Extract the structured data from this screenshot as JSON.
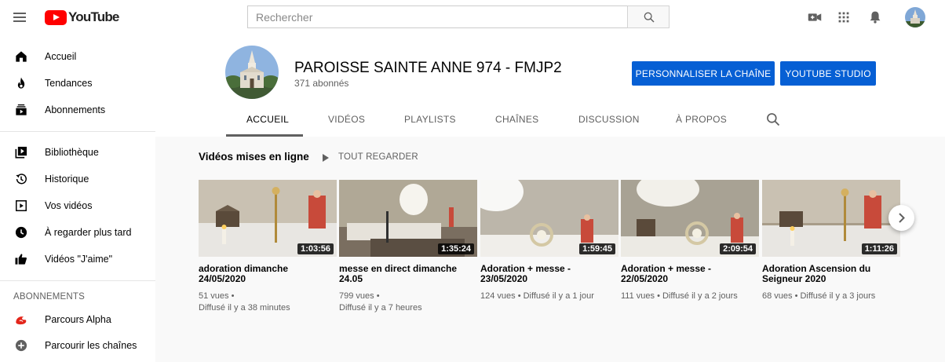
{
  "topbar": {
    "logo_text": "YouTube",
    "search_placeholder": "Rechercher",
    "icons": [
      "menu-icon",
      "search-icon",
      "video-camera-icon",
      "apps-grid-icon",
      "bell-icon",
      "avatar"
    ]
  },
  "sidebar": {
    "main": [
      {
        "label": "Accueil",
        "icon": "home-icon"
      },
      {
        "label": "Tendances",
        "icon": "flame-icon"
      },
      {
        "label": "Abonnements",
        "icon": "subscriptions-icon"
      }
    ],
    "library": [
      {
        "label": "Bibliothèque",
        "icon": "library-icon"
      },
      {
        "label": "Historique",
        "icon": "history-icon"
      },
      {
        "label": "Vos vidéos",
        "icon": "your-videos-icon"
      },
      {
        "label": "À regarder plus tard",
        "icon": "clock-icon"
      },
      {
        "label": "Vidéos \"J'aime\"",
        "icon": "thumbs-up-icon"
      }
    ],
    "subscriptions_title": "ABONNEMENTS",
    "subscriptions": [
      {
        "label": "Parcours Alpha",
        "icon": "alpha-logo-icon"
      },
      {
        "label": "Parcourir les chaînes",
        "icon": "plus-circle-icon"
      }
    ]
  },
  "channel": {
    "name": "PAROISSE SAINTE ANNE 974 - FMJP2",
    "subscribers": "371 abonnés",
    "customize_button": "PERSONNALISER LA CHAÎNE",
    "studio_button": "YOUTUBE STUDIO",
    "tabs": [
      "ACCUEIL",
      "VIDÉOS",
      "PLAYLISTS",
      "CHAÎNES",
      "DISCUSSION",
      "À PROPOS"
    ],
    "active_tab": "ACCUEIL"
  },
  "shelf": {
    "title": "Vidéos mises en ligne",
    "play_all": "TOUT REGARDER",
    "videos": [
      {
        "title": "adoration dimanche 24/05/2020",
        "duration": "1:03:56",
        "views": "51 vues •",
        "age": "Diffusé il y a 38 minutes"
      },
      {
        "title": "messe en direct dimanche 24.05",
        "duration": "1:35:24",
        "views": "799 vues •",
        "age": "Diffusé il y a 7 heures"
      },
      {
        "title": "Adoration + messe - 23/05/2020",
        "duration": "1:59:45",
        "views": "124 vues • Diffusé il y a 1 jour",
        "age": ""
      },
      {
        "title": "Adoration + messe - 22/05/2020",
        "duration": "2:09:54",
        "views": "111 vues • Diffusé il y a 2 jours",
        "age": ""
      },
      {
        "title": "Adoration Ascension du Seigneur 2020",
        "duration": "1:11:26",
        "views": "68 vues • Diffusé il y a 3 jours",
        "age": ""
      }
    ]
  },
  "colors": {
    "brand_red": "#ff0000",
    "primary_blue": "#065fd4",
    "text_primary": "#030303",
    "text_secondary": "#606060"
  }
}
